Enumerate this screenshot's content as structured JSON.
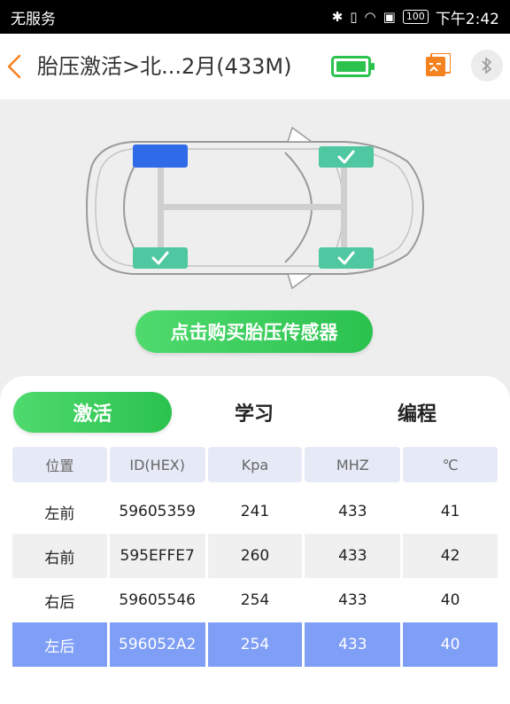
{
  "status_bar": {
    "carrier": "无服务",
    "battery": "100",
    "time": "下午2:42"
  },
  "header": {
    "title": "胎压激活>北...2月(433M)"
  },
  "car": {
    "buy_button": "点击购买胎压传感器"
  },
  "tabs": [
    "激活",
    "学习",
    "编程"
  ],
  "table": {
    "columns": [
      "位置",
      "ID(HEX)",
      "Kpa",
      "MHZ",
      "℃"
    ],
    "rows": [
      [
        "左前",
        "59605359",
        "241",
        "433",
        "41"
      ],
      [
        "右前",
        "595EFFE7",
        "260",
        "433",
        "42"
      ],
      [
        "右后",
        "59605546",
        "254",
        "433",
        "40"
      ],
      [
        "左后",
        "596052A2",
        "254",
        "433",
        "40"
      ]
    ]
  },
  "colors": {
    "accent_green": "#2bc24e",
    "accent_orange": "#f58220",
    "selected_row": "#7f9ef5",
    "wheel_active": "#2f6ae8"
  }
}
